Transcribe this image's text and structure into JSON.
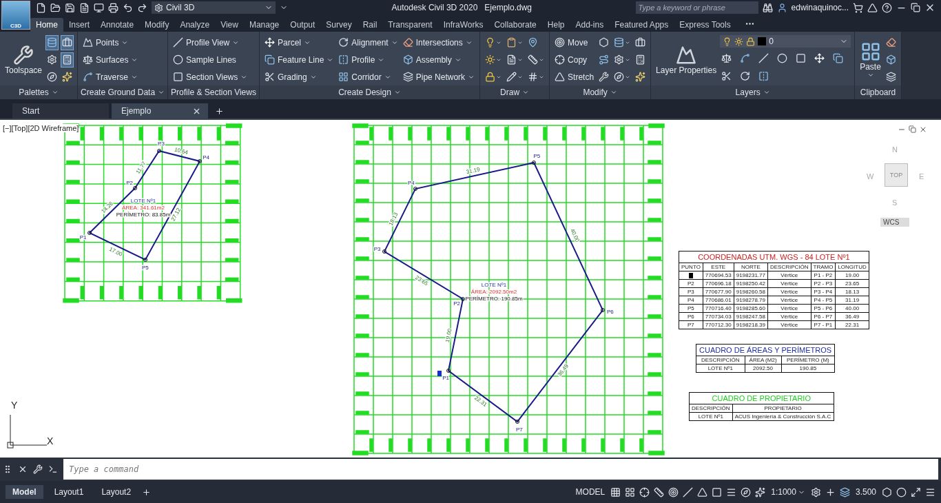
{
  "app": {
    "logo": "C3D",
    "workspace": "Civil 3D",
    "title": "Autodesk Civil 3D 2020",
    "document": "Ejemplo.dwg",
    "search_placeholder": "Type a keyword or phrase",
    "user": "edwinaquinoc..."
  },
  "ribbon_tabs": [
    {
      "label": "Home",
      "selected": true
    },
    {
      "label": "Insert",
      "selected": false
    },
    {
      "label": "Annotate",
      "selected": false
    },
    {
      "label": "Modify",
      "selected": false
    },
    {
      "label": "Analyze",
      "selected": false
    },
    {
      "label": "View",
      "selected": false
    },
    {
      "label": "Manage",
      "selected": false
    },
    {
      "label": "Output",
      "selected": false
    },
    {
      "label": "Survey",
      "selected": false
    },
    {
      "label": "Rail",
      "selected": false
    },
    {
      "label": "Transparent",
      "selected": false
    },
    {
      "label": "InfraWorks",
      "selected": false
    },
    {
      "label": "Collaborate",
      "selected": false
    },
    {
      "label": "Help",
      "selected": false
    },
    {
      "label": "Add-ins",
      "selected": false
    },
    {
      "label": "Featured Apps",
      "selected": false
    },
    {
      "label": "Express Tools",
      "selected": false
    }
  ],
  "ribbon_panels": [
    {
      "title": "Palettes",
      "dropdown": true,
      "columns": [
        {
          "kind": "stack",
          "items": [
            {
              "kind": "large",
              "label": "Toolspace",
              "dropdown": false
            }
          ]
        },
        {
          "kind": "stack",
          "items": [
            {
              "kind": "icon",
              "dropdown": false,
              "on": true
            },
            {
              "kind": "icon",
              "dropdown": false,
              "on": false
            },
            {
              "kind": "icon",
              "dropdown": false,
              "on": false
            }
          ]
        },
        {
          "kind": "stack",
          "items": [
            {
              "kind": "icon",
              "dropdown": false,
              "on": true
            },
            {
              "kind": "icon",
              "dropdown": false,
              "on": true
            },
            {
              "kind": "icon",
              "dropdown": false,
              "on": false
            }
          ]
        }
      ]
    },
    {
      "title": "Create Ground Data",
      "dropdown": true,
      "columns": [
        {
          "kind": "stack",
          "items": [
            {
              "kind": "small",
              "label": "Points",
              "dropdown": true
            },
            {
              "kind": "small",
              "label": "Surfaces",
              "dropdown": true
            },
            {
              "kind": "small",
              "label": "Traverse",
              "dropdown": true
            }
          ]
        }
      ]
    },
    {
      "title": "Profile & Section Views",
      "dropdown": false,
      "columns": [
        {
          "kind": "stack",
          "items": [
            {
              "kind": "small",
              "label": "Profile View",
              "dropdown": true
            },
            {
              "kind": "small",
              "label": "Sample Lines",
              "dropdown": false
            },
            {
              "kind": "small",
              "label": "Section Views",
              "dropdown": true
            }
          ]
        }
      ]
    },
    {
      "title": "Create Design",
      "dropdown": true,
      "columns": [
        {
          "kind": "stack",
          "items": [
            {
              "kind": "small",
              "label": "Parcel",
              "dropdown": true
            },
            {
              "kind": "small",
              "label": "Feature Line",
              "dropdown": true
            },
            {
              "kind": "small",
              "label": "Grading",
              "dropdown": true
            }
          ]
        },
        {
          "kind": "stack",
          "items": [
            {
              "kind": "small",
              "label": "Alignment",
              "dropdown": true
            },
            {
              "kind": "small",
              "label": "Profile",
              "dropdown": true
            },
            {
              "kind": "small",
              "label": "Corridor",
              "dropdown": true
            }
          ]
        },
        {
          "kind": "stack",
          "items": [
            {
              "kind": "small",
              "label": "Intersections",
              "dropdown": true
            },
            {
              "kind": "small",
              "label": "Assembly",
              "dropdown": true
            },
            {
              "kind": "small",
              "label": "Pipe Network",
              "dropdown": true
            }
          ]
        }
      ]
    },
    {
      "title": "Draw",
      "dropdown": true,
      "columns": [
        {
          "kind": "stack",
          "items": [
            {
              "kind": "icon",
              "dropdown": true
            },
            {
              "kind": "icon",
              "dropdown": true
            },
            {
              "kind": "icon",
              "dropdown": true
            }
          ]
        },
        {
          "kind": "stack",
          "items": [
            {
              "kind": "icon",
              "dropdown": true
            },
            {
              "kind": "icon",
              "dropdown": true
            },
            {
              "kind": "icon",
              "dropdown": true
            }
          ]
        },
        {
          "kind": "stack",
          "items": [
            {
              "kind": "icon",
              "dropdown": false
            },
            {
              "kind": "icon",
              "dropdown": true
            },
            {
              "kind": "icon",
              "dropdown": true
            }
          ]
        }
      ]
    },
    {
      "title": "Modify",
      "dropdown": true,
      "columns": [
        {
          "kind": "stack",
          "items": [
            {
              "kind": "small",
              "label": "Move",
              "dropdown": false
            },
            {
              "kind": "small",
              "label": "Copy",
              "dropdown": false
            },
            {
              "kind": "small",
              "label": "Stretch",
              "dropdown": false
            }
          ]
        },
        {
          "kind": "stack",
          "items": [
            {
              "kind": "icon",
              "dropdown": false
            },
            {
              "kind": "icon",
              "dropdown": false
            },
            {
              "kind": "icon",
              "dropdown": false
            }
          ]
        },
        {
          "kind": "stack",
          "items": [
            {
              "kind": "icon",
              "dropdown": true
            },
            {
              "kind": "icon",
              "dropdown": true
            },
            {
              "kind": "icon",
              "dropdown": true
            }
          ]
        },
        {
          "kind": "stack",
          "items": [
            {
              "kind": "icon",
              "dropdown": false
            },
            {
              "kind": "icon",
              "dropdown": false
            },
            {
              "kind": "icon",
              "dropdown": false
            }
          ]
        }
      ]
    },
    {
      "title": "Layers",
      "dropdown": true,
      "columns": [
        {
          "kind": "stack",
          "items": [
            {
              "kind": "large",
              "label": "Layer Properties",
              "dropdown": false
            }
          ]
        },
        {
          "kind": "layer-grid",
          "current_layer": "0",
          "items": [
            {
              "kind": "icon",
              "dropdown": false
            },
            {
              "kind": "icon",
              "dropdown": false
            },
            {
              "kind": "icon",
              "dropdown": false
            },
            {
              "kind": "icon",
              "dropdown": false
            },
            {
              "kind": "icon",
              "dropdown": false
            },
            {
              "kind": "icon",
              "dropdown": false
            },
            {
              "kind": "icon",
              "dropdown": false
            },
            {
              "kind": "icon",
              "dropdown": false
            },
            {
              "kind": "icon",
              "dropdown": false
            },
            {
              "kind": "icon",
              "dropdown": false
            }
          ]
        }
      ]
    },
    {
      "title": "Clipboard",
      "dropdown": false,
      "columns": [
        {
          "kind": "stack",
          "items": [
            {
              "kind": "large",
              "label": "Paste",
              "dropdown": true
            }
          ]
        },
        {
          "kind": "stack",
          "items": [
            {
              "kind": "icon",
              "dropdown": false
            },
            {
              "kind": "icon",
              "dropdown": false
            },
            {
              "kind": "icon",
              "dropdown": false
            }
          ]
        }
      ]
    }
  ],
  "file_tabs": [
    {
      "label": "Start",
      "selected": false,
      "closable": false
    },
    {
      "label": "Ejemplo",
      "selected": true,
      "closable": true
    }
  ],
  "viewport": {
    "label": "[−][Top][2D Wireframe]",
    "view_cube": {
      "north": "N",
      "south": "S",
      "east": "E",
      "west": "W",
      "face": "TOP",
      "ucs": "WCS"
    },
    "ucs_axes": {
      "x": "X",
      "y": "Y"
    }
  },
  "drawings": [
    {
      "points": [
        "P1",
        "P2",
        "P3",
        "P4",
        "P5"
      ],
      "segments": [
        "14.26",
        "11.77",
        "10.64",
        "27.12",
        "17.00"
      ],
      "lot": "LOTE Nº1",
      "area": "ÁREA: 341.61m2",
      "perimeter": "PERÍMETRO: 83.85m"
    },
    {
      "points": [
        "P1",
        "P2",
        "P3",
        "P4",
        "P5",
        "P6",
        "P7"
      ],
      "segments": [
        "19.00",
        "23.65",
        "18.13",
        "31.19",
        "40.00",
        "36.49",
        "22.31"
      ],
      "lot": "LOTE Nº1",
      "area": "ÁREA: 2092.50m2",
      "perimeter": "PERÍMETRO: 190.85m"
    }
  ],
  "coordinates_table": {
    "title": "COORDENADAS UTM. WGS - 84  LOTE Nº1",
    "columns": [
      "PUNTO",
      "ESTE",
      "NORTE",
      "DESCRIPCIÓN",
      "TRAMO",
      "LONGITUD"
    ],
    "rows": [
      {
        "marked": true,
        "cells": [
          "",
          "770694.53",
          "9198231.77",
          "Vértice",
          "P1 - P2",
          "19.00"
        ]
      },
      {
        "marked": false,
        "cells": [
          "P2",
          "770696.18",
          "9198250.42",
          "Vértice",
          "P2 - P3",
          "23.65"
        ]
      },
      {
        "marked": false,
        "cells": [
          "P3",
          "770677.90",
          "9198260.58",
          "Vértice",
          "P3 - P4",
          "18.13"
        ]
      },
      {
        "marked": false,
        "cells": [
          "P4",
          "770686.01",
          "9198278.79",
          "Vértice",
          "P4 - P5",
          "31.19"
        ]
      },
      {
        "marked": false,
        "cells": [
          "P5",
          "770716.40",
          "9198285.60",
          "Vértice",
          "P5 - P6",
          "40.00"
        ]
      },
      {
        "marked": false,
        "cells": [
          "P6",
          "770734.03",
          "9198247.58",
          "Vértice",
          "P6 - P7",
          "36.49"
        ]
      },
      {
        "marked": false,
        "cells": [
          "P7",
          "770712.30",
          "9198218.39",
          "Vértice",
          "P7 - P1",
          "22.31"
        ]
      }
    ]
  },
  "areas_table": {
    "title": "CUADRO DE ÁREAS Y PERÍMETROS",
    "columns": [
      "DESCRIPCIÓN",
      "ÁREA (M2)",
      "PERÍMETRO (M)"
    ],
    "rows": [
      [
        "LOTE Nº1",
        "2092.50",
        "190.85"
      ]
    ]
  },
  "owner_table": {
    "title": "CUADRO DE PROPIETARIO",
    "columns": [
      "DESCRIPCIÓN",
      "PROPIETARIO"
    ],
    "rows": [
      [
        "LOTE Nº1",
        "ACUS Ingeniería & Construcción S.A.C"
      ]
    ]
  },
  "command_line": {
    "placeholder": "Type a command"
  },
  "status_bar": {
    "layout_tabs": [
      {
        "label": "Model",
        "selected": true
      },
      {
        "label": "Layout1",
        "selected": false
      },
      {
        "label": "Layout2",
        "selected": false
      }
    ],
    "space": "MODEL",
    "scale": "1:1000",
    "annotation_scale": "3.500"
  }
}
